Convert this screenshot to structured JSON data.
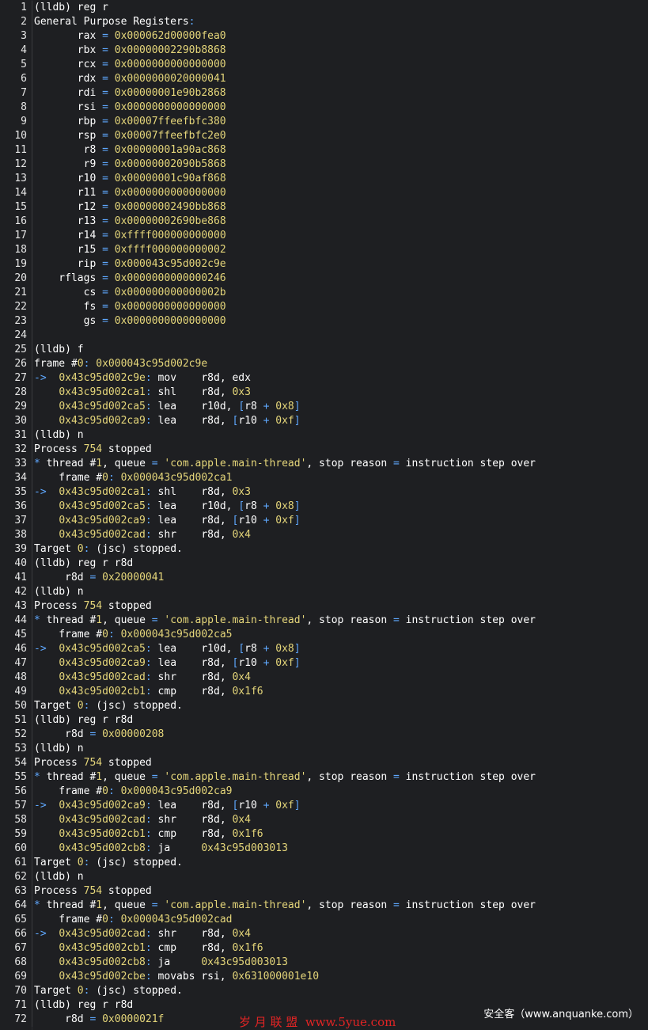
{
  "colors": {
    "background": "#1e1f22",
    "text": "#ffffff",
    "value": "#e5d67a",
    "accent": "#5fa8ff",
    "string": "#e5d67a",
    "line_number": "#e6e6e6",
    "watermark_red": "#e02424"
  },
  "editor": {
    "lines": [
      {
        "n": "1",
        "t": "(lldb) reg r"
      },
      {
        "n": "2",
        "t": "General Purpose Registers:"
      },
      {
        "n": "3",
        "t": "       rax = 0x000062d00000fea0"
      },
      {
        "n": "4",
        "t": "       rbx = 0x00000002290b8868"
      },
      {
        "n": "5",
        "t": "       rcx = 0x0000000000000000"
      },
      {
        "n": "6",
        "t": "       rdx = 0x0000000020000041"
      },
      {
        "n": "7",
        "t": "       rdi = 0x00000001e90b2868"
      },
      {
        "n": "8",
        "t": "       rsi = 0x0000000000000000"
      },
      {
        "n": "9",
        "t": "       rbp = 0x00007ffeefbfc380"
      },
      {
        "n": "10",
        "t": "       rsp = 0x00007ffeefbfc2e0"
      },
      {
        "n": "11",
        "t": "        r8 = 0x00000001a90ac868"
      },
      {
        "n": "12",
        "t": "        r9 = 0x00000002090b5868"
      },
      {
        "n": "13",
        "t": "       r10 = 0x00000001c90af868"
      },
      {
        "n": "14",
        "t": "       r11 = 0x0000000000000000"
      },
      {
        "n": "15",
        "t": "       r12 = 0x00000002490bb868"
      },
      {
        "n": "16",
        "t": "       r13 = 0x00000002690be868"
      },
      {
        "n": "17",
        "t": "       r14 = 0xffff000000000000"
      },
      {
        "n": "18",
        "t": "       r15 = 0xffff000000000002"
      },
      {
        "n": "19",
        "t": "       rip = 0x000043c95d002c9e"
      },
      {
        "n": "20",
        "t": "    rflags = 0x0000000000000246"
      },
      {
        "n": "21",
        "t": "        cs = 0x000000000000002b"
      },
      {
        "n": "22",
        "t": "        fs = 0x0000000000000000"
      },
      {
        "n": "23",
        "t": "        gs = 0x0000000000000000"
      },
      {
        "n": "24",
        "t": ""
      },
      {
        "n": "25",
        "t": "(lldb) f"
      },
      {
        "n": "26",
        "t": "frame #0: 0x000043c95d002c9e"
      },
      {
        "n": "27",
        "t": "->  0x43c95d002c9e: mov    r8d, edx"
      },
      {
        "n": "28",
        "t": "    0x43c95d002ca1: shl    r8d, 0x3"
      },
      {
        "n": "29",
        "t": "    0x43c95d002ca5: lea    r10d, [r8 + 0x8]"
      },
      {
        "n": "30",
        "t": "    0x43c95d002ca9: lea    r8d, [r10 + 0xf]"
      },
      {
        "n": "31",
        "t": "(lldb) n"
      },
      {
        "n": "32",
        "t": "Process 754 stopped"
      },
      {
        "n": "33",
        "t": "* thread #1, queue = 'com.apple.main-thread', stop reason = instruction step over"
      },
      {
        "n": "34",
        "t": "    frame #0: 0x000043c95d002ca1"
      },
      {
        "n": "35",
        "t": "->  0x43c95d002ca1: shl    r8d, 0x3"
      },
      {
        "n": "36",
        "t": "    0x43c95d002ca5: lea    r10d, [r8 + 0x8]"
      },
      {
        "n": "37",
        "t": "    0x43c95d002ca9: lea    r8d, [r10 + 0xf]"
      },
      {
        "n": "38",
        "t": "    0x43c95d002cad: shr    r8d, 0x4"
      },
      {
        "n": "39",
        "t": "Target 0: (jsc) stopped."
      },
      {
        "n": "40",
        "t": "(lldb) reg r r8d"
      },
      {
        "n": "41",
        "t": "     r8d = 0x20000041"
      },
      {
        "n": "42",
        "t": "(lldb) n"
      },
      {
        "n": "43",
        "t": "Process 754 stopped"
      },
      {
        "n": "44",
        "t": "* thread #1, queue = 'com.apple.main-thread', stop reason = instruction step over"
      },
      {
        "n": "45",
        "t": "    frame #0: 0x000043c95d002ca5"
      },
      {
        "n": "46",
        "t": "->  0x43c95d002ca5: lea    r10d, [r8 + 0x8]"
      },
      {
        "n": "47",
        "t": "    0x43c95d002ca9: lea    r8d, [r10 + 0xf]"
      },
      {
        "n": "48",
        "t": "    0x43c95d002cad: shr    r8d, 0x4"
      },
      {
        "n": "49",
        "t": "    0x43c95d002cb1: cmp    r8d, 0x1f6"
      },
      {
        "n": "50",
        "t": "Target 0: (jsc) stopped."
      },
      {
        "n": "51",
        "t": "(lldb) reg r r8d"
      },
      {
        "n": "52",
        "t": "     r8d = 0x00000208"
      },
      {
        "n": "53",
        "t": "(lldb) n"
      },
      {
        "n": "54",
        "t": "Process 754 stopped"
      },
      {
        "n": "55",
        "t": "* thread #1, queue = 'com.apple.main-thread', stop reason = instruction step over"
      },
      {
        "n": "56",
        "t": "    frame #0: 0x000043c95d002ca9"
      },
      {
        "n": "57",
        "t": "->  0x43c95d002ca9: lea    r8d, [r10 + 0xf]"
      },
      {
        "n": "58",
        "t": "    0x43c95d002cad: shr    r8d, 0x4"
      },
      {
        "n": "59",
        "t": "    0x43c95d002cb1: cmp    r8d, 0x1f6"
      },
      {
        "n": "60",
        "t": "    0x43c95d002cb8: ja     0x43c95d003013"
      },
      {
        "n": "61",
        "t": "Target 0: (jsc) stopped."
      },
      {
        "n": "62",
        "t": "(lldb) n"
      },
      {
        "n": "63",
        "t": "Process 754 stopped"
      },
      {
        "n": "64",
        "t": "* thread #1, queue = 'com.apple.main-thread', stop reason = instruction step over"
      },
      {
        "n": "65",
        "t": "    frame #0: 0x000043c95d002cad"
      },
      {
        "n": "66",
        "t": "->  0x43c95d002cad: shr    r8d, 0x4"
      },
      {
        "n": "67",
        "t": "    0x43c95d002cb1: cmp    r8d, 0x1f6"
      },
      {
        "n": "68",
        "t": "    0x43c95d002cb8: ja     0x43c95d003013"
      },
      {
        "n": "69",
        "t": "    0x43c95d002cbe: movabs rsi, 0x631000001e10"
      },
      {
        "n": "70",
        "t": "Target 0: (jsc) stopped."
      },
      {
        "n": "71",
        "t": "(lldb) reg r r8d"
      },
      {
        "n": "72",
        "t": "     r8d = 0x0000021f"
      }
    ]
  },
  "watermarks": {
    "site_cn": "岁 月 联 盟  www.5yue.com",
    "site_anquanke": "安全客（www.anquanke.com）"
  }
}
